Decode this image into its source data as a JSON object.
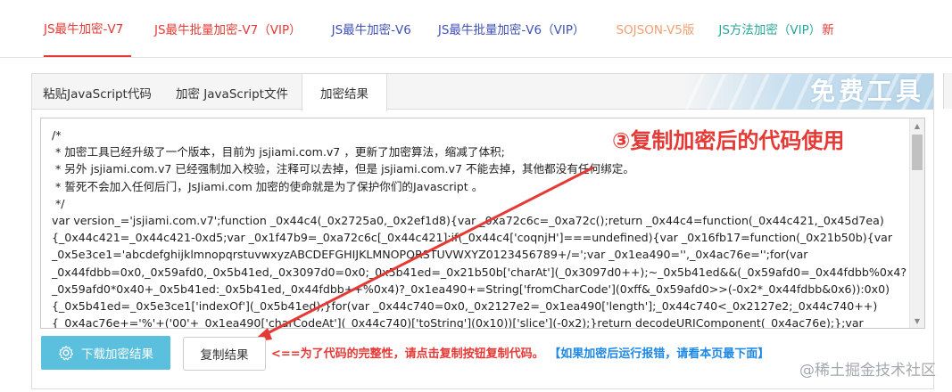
{
  "top_tabs": [
    {
      "label": "JS最牛加密-V7",
      "color": "#e53935",
      "active": true
    },
    {
      "label": "JS最牛批量加密-V7（VIP）",
      "color": "#e53935"
    },
    {
      "label": "JS最牛加密-V6",
      "color": "#3f51b5"
    },
    {
      "label": "JS最牛批量加密-V6（VIP）",
      "color": "#3f51b5"
    },
    {
      "label": "SOJSON-V5版",
      "color": "#f0a070"
    },
    {
      "label": "JS方法加密（VIP）",
      "color": "#26a69a",
      "badge": "新"
    }
  ],
  "inner_tabs": [
    {
      "label": "粘贴JavaScript代码"
    },
    {
      "label": "加密 JavaScript文件"
    },
    {
      "label": "加密结果",
      "active": true
    }
  ],
  "banner_text": "免费工具",
  "annotation": "③复制加密后的代码使用",
  "code_lines": [
    "/*",
    " * 加密工具已经升级了一个版本，目前为 jsjiami.com.v7 ，更新了加密算法，缩减了体积;",
    " * 另外 jsjiami.com.v7 已经强制加入校验，注释可以去掉，但是 jsjiami.com.v7 不能去掉，其他都没有任何绑定。",
    " * 誓死不会加入任何后门，JsJiami.com 加密的使命就是为了保护你们的Javascript 。",
    " */",
    "var version_='jsjiami.com.v7';function _0x44c4(_0x2725a0,_0x2ef1d8){var _0xa72c6c=_0xa72c();return _0x44c4=function(_0x44c421,_0x45d7ea)",
    "{_0x44c421=_0x44c421-0xd5;var _0x1f47b9=_0xa72c6c[_0x44c421];if(_0x44c4['coqnjH']===undefined){var _0x16fb17=function(_0x21b50b){var",
    "_0x5e3ce1='abcdefghijklmnopqrstuvwxyzABCDEFGHIJKLMNOPQRSTUVWXYZ0123456789+/=';var _0x1ea490='',_0x4ac76e='';for(var",
    "_0x44fdbb=0x0,_0x59afd0,_0x5b41ed,_0x3097d0=0x0;_0x5b41ed=_0x21b50b['charAt'](_0x3097d0++);~_0x5b41ed&&(_0x59afd0=_0x44fdbb%0x4?",
    "_0x59afd0*0x40+_0x5b41ed:_0x5b41ed,_0x44fdbb++%0x4)?_0x1ea490+=String['fromCharCode'](0xff&_0x59afd0>>(-0x2*_0x44fdbb&0x6)):0x0)",
    "{_0x5b41ed=_0x5e3ce1['indexOf'](_0x5b41ed);}for(var _0x44c740=0x0,_0x2127e2=_0x1ea490['length'];_0x44c740<_0x2127e2;_0x44c740++)",
    "{_0x4ac76e+='%'+('00'+_0x1ea490['charCodeAt'](_0x44c740)['toString'](0x10))['slice'](-0x2);}return decodeURIComponent(_0x4ac76e);};var"
  ],
  "buttons": {
    "download": "下载加密结果",
    "copy": "复制结果"
  },
  "hint_red": "<==为了代码的完整性，请点击复制按钮复制代码。",
  "hint_blue": "【如果加密后运行报错，请看本页最下面】",
  "watermark": "@稀土掘金技术社区",
  "icons": {
    "download": "gear-icon",
    "scroll_up": "arrow-up-icon",
    "scroll_down": "arrow-down-icon"
  },
  "colors": {
    "accent_red": "#e53935",
    "button_blue": "#5bc0de",
    "hint_blue": "#1e88e5"
  }
}
